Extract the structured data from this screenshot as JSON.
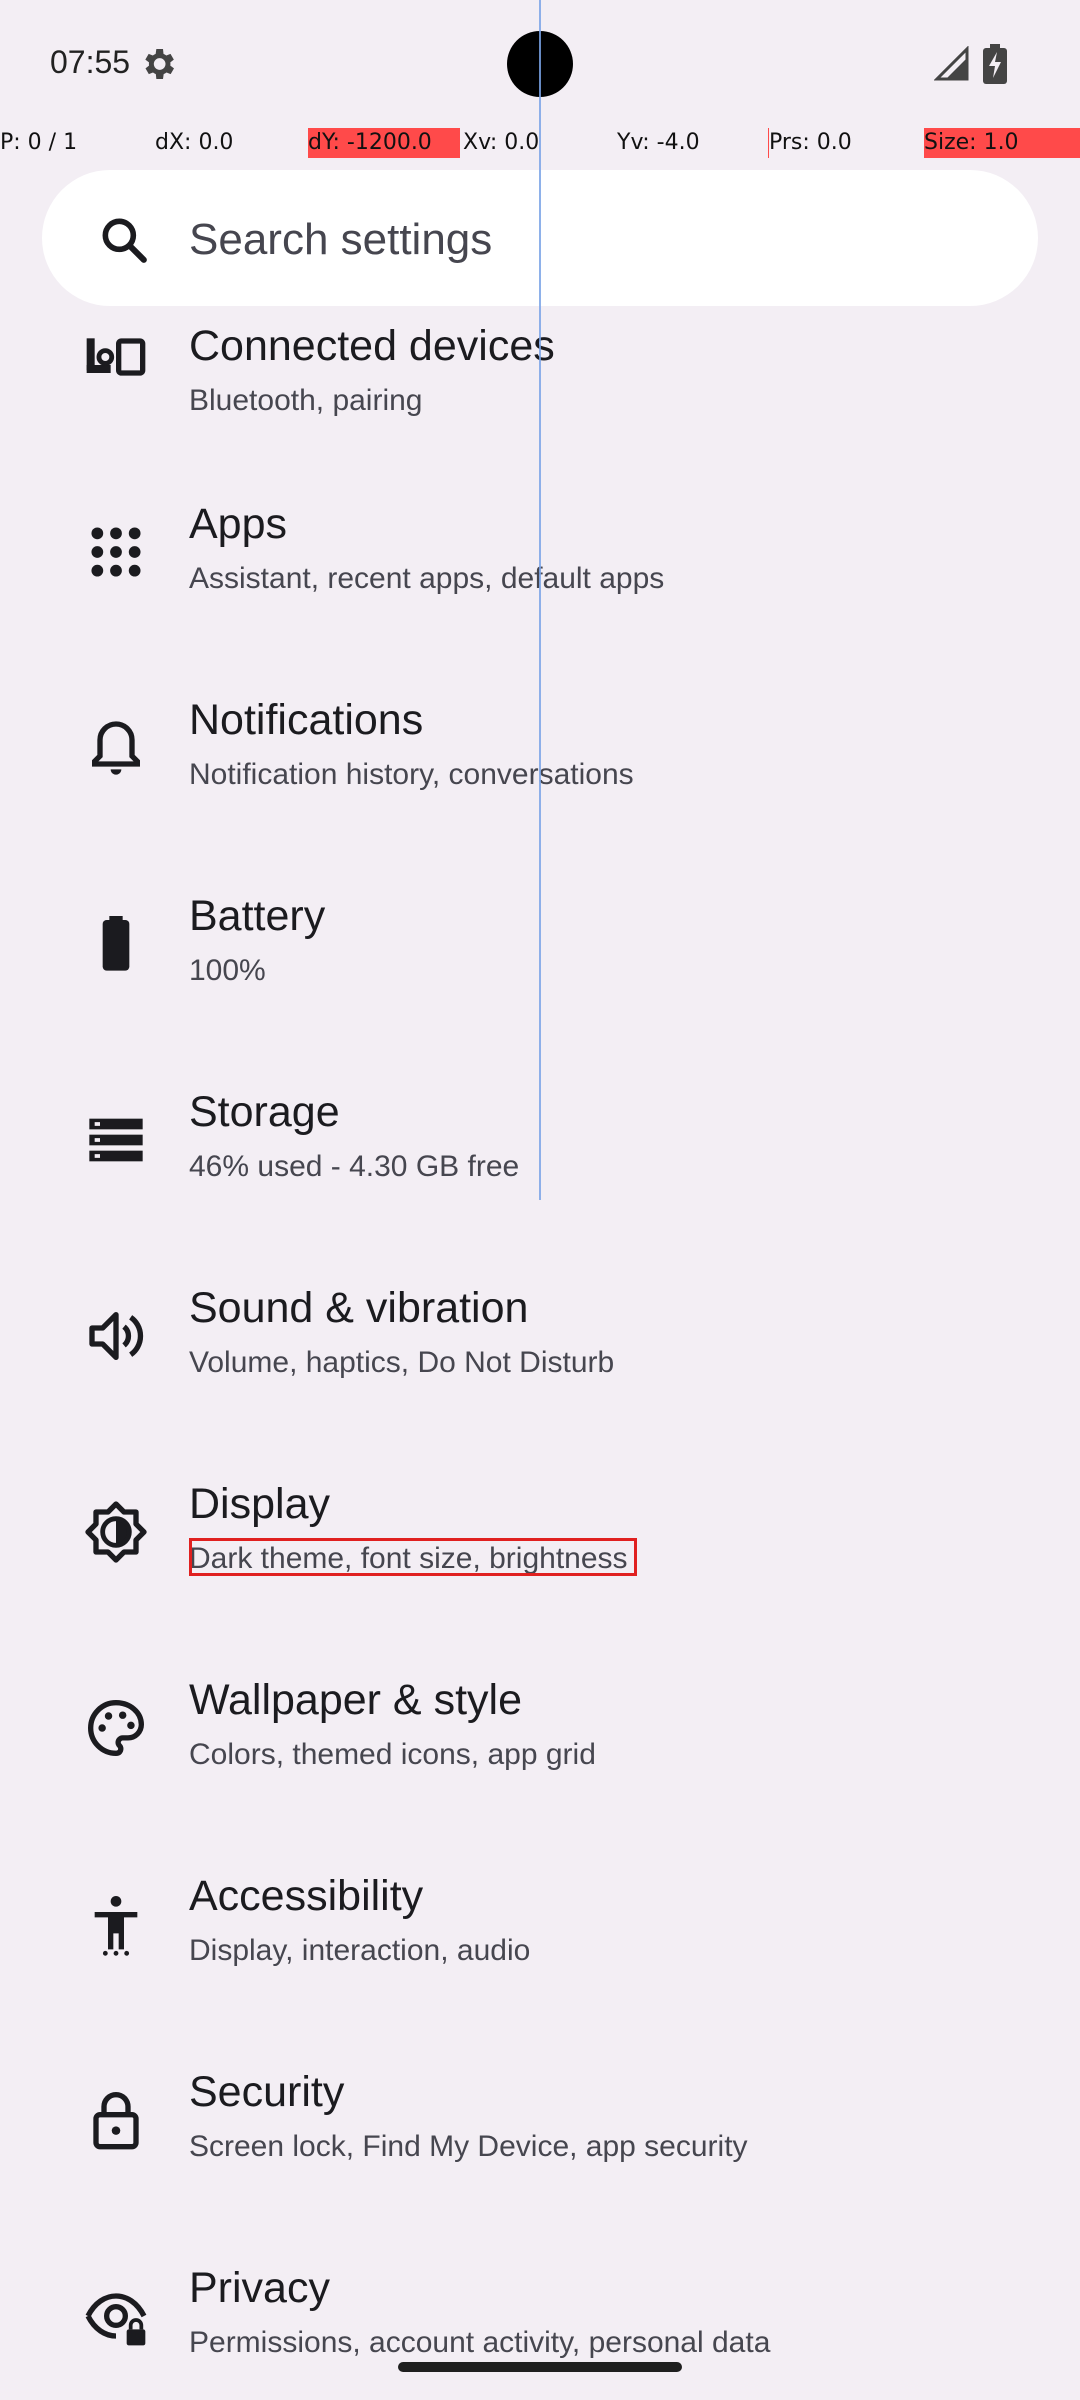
{
  "status_bar": {
    "time": "07:55",
    "icons": [
      "gear-icon",
      "signal-icon",
      "battery-charging-icon"
    ]
  },
  "debug_overlay": {
    "pointer": "P: 0 / 1",
    "dx": "dX: 0.0",
    "dy": "dY: -1200.0",
    "xv": "Xv: 0.0",
    "yv": "Yv: -4.0",
    "prs": "Prs: 0.0",
    "size": "Size: 1.0",
    "highlight_color": "#ff4a4a"
  },
  "search": {
    "placeholder": "Search settings"
  },
  "settings_items": [
    {
      "icon": "connected-devices-icon",
      "title": "Connected devices",
      "subtitle": "Bluetooth, pairing"
    },
    {
      "icon": "apps-icon",
      "title": "Apps",
      "subtitle": "Assistant, recent apps, default apps"
    },
    {
      "icon": "bell-icon",
      "title": "Notifications",
      "subtitle": "Notification history, conversations"
    },
    {
      "icon": "battery-icon",
      "title": "Battery",
      "subtitle": "100%"
    },
    {
      "icon": "storage-icon",
      "title": "Storage",
      "subtitle": "46% used - 4.30 GB free"
    },
    {
      "icon": "speaker-icon",
      "title": "Sound & vibration",
      "subtitle": "Volume, haptics, Do Not Disturb"
    },
    {
      "icon": "brightness-icon",
      "title": "Display",
      "subtitle": "Dark theme, font size, brightness"
    },
    {
      "icon": "palette-icon",
      "title": "Wallpaper & style",
      "subtitle": "Colors, themed icons, app grid"
    },
    {
      "icon": "accessibility-icon",
      "title": "Accessibility",
      "subtitle": "Display, interaction, audio"
    },
    {
      "icon": "lock-icon",
      "title": "Security",
      "subtitle": "Screen lock, Find My Device, app security"
    },
    {
      "icon": "privacy-eye-icon",
      "title": "Privacy",
      "subtitle": "Permissions, account activity, personal data"
    }
  ],
  "colors": {
    "background": "#f3eef4",
    "search_background": "#ffffff",
    "highlight_outline": "#e02020"
  }
}
